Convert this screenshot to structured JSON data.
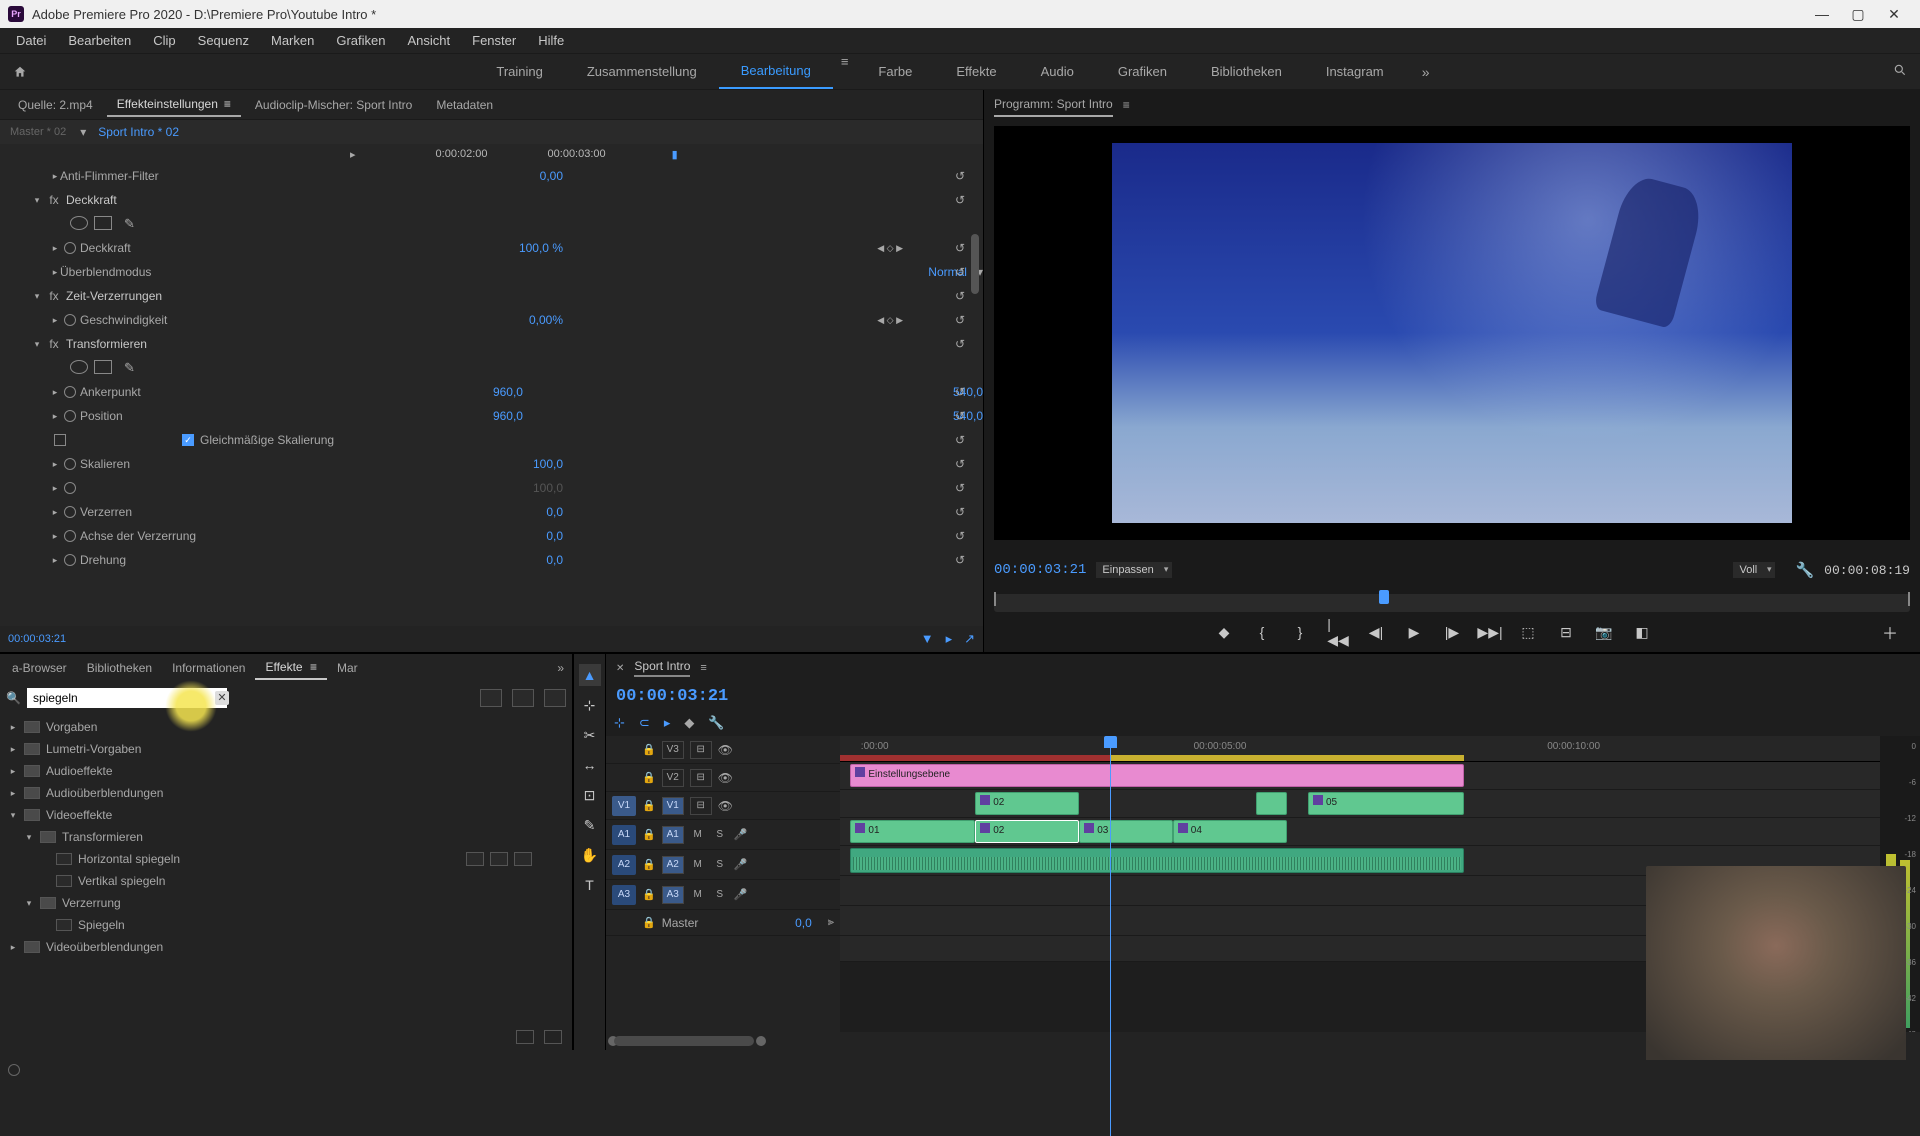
{
  "titlebar": {
    "app_icon_text": "Pr",
    "title": "Adobe Premiere Pro 2020 - D:\\Premiere Pro\\Youtube Intro *"
  },
  "menubar": [
    "Datei",
    "Bearbeiten",
    "Clip",
    "Sequenz",
    "Marken",
    "Grafiken",
    "Ansicht",
    "Fenster",
    "Hilfe"
  ],
  "workspaces": [
    "Training",
    "Zusammenstellung",
    "Bearbeitung",
    "Farbe",
    "Effekte",
    "Audio",
    "Grafiken",
    "Bibliotheken",
    "Instagram"
  ],
  "workspace_active": "Bearbeitung",
  "source_tabs": {
    "source": "Quelle: 2.mp4",
    "effect_controls": "Effekteinstellungen",
    "audio_mixer": "Audioclip-Mischer: Sport Intro",
    "metadata": "Metadaten"
  },
  "effect_controls": {
    "master": "Master * 02",
    "current": "Sport Intro * 02",
    "tc_in": "0:00:02:00",
    "tc_out": "00:00:03:00",
    "footer_tc": "00:00:03:21",
    "rows": [
      {
        "type": "prop",
        "label": "Anti-Flimmer-Filter",
        "val": "0,00",
        "indent": 2
      },
      {
        "type": "section",
        "label": "Deckkraft",
        "indent": 1,
        "fx": true,
        "masks": true
      },
      {
        "type": "prop",
        "label": "Deckkraft",
        "val": "100,0 %",
        "indent": 2,
        "kf": true,
        "sw": true
      },
      {
        "type": "prop",
        "label": "Überblendmodus",
        "val": "Normal",
        "indent": 2,
        "dropdown": true
      },
      {
        "type": "section",
        "label": "Zeit-Verzerrungen",
        "indent": 1,
        "fx": true
      },
      {
        "type": "prop",
        "label": "Geschwindigkeit",
        "val": "0,00%",
        "indent": 2,
        "kf": true,
        "sw": true
      },
      {
        "type": "section",
        "label": "Transformieren",
        "indent": 1,
        "fx": true,
        "masks": true
      },
      {
        "type": "prop",
        "label": "Ankerpunkt",
        "val": "960,0",
        "val2": "540,0",
        "indent": 2,
        "sw": true
      },
      {
        "type": "prop",
        "label": "Position",
        "val": "960,0",
        "val2": "540,0",
        "indent": 2,
        "sw": true
      },
      {
        "type": "check",
        "label": "Gleichmäßige Skalierung",
        "indent": 2,
        "checked": true
      },
      {
        "type": "prop",
        "label": "Skalieren",
        "val": "100,0",
        "indent": 2,
        "sw": true
      },
      {
        "type": "prop",
        "label": "",
        "val": "100,0",
        "indent": 2,
        "dim": true,
        "sw": true
      },
      {
        "type": "prop",
        "label": "Verzerren",
        "val": "0,0",
        "indent": 2,
        "sw": true
      },
      {
        "type": "prop",
        "label": "Achse der Verzerrung",
        "val": "0,0",
        "indent": 2,
        "sw": true
      },
      {
        "type": "prop",
        "label": "Drehung",
        "val": "0,0",
        "indent": 2,
        "sw": true
      }
    ]
  },
  "program": {
    "title": "Programm: Sport Intro",
    "tc": "00:00:03:21",
    "zoom": "Einpassen",
    "res": "Voll",
    "duration": "00:00:08:19"
  },
  "effects_panel": {
    "tabs": [
      "a-Browser",
      "Bibliotheken",
      "Informationen",
      "Effekte",
      "Mar"
    ],
    "active": "Effekte",
    "search": "spiegeln",
    "tree": [
      {
        "label": "Vorgaben",
        "d": 0,
        "folder": true,
        "tw": "▸"
      },
      {
        "label": "Lumetri-Vorgaben",
        "d": 0,
        "folder": true,
        "tw": "▸"
      },
      {
        "label": "Audioeffekte",
        "d": 0,
        "folder": true,
        "tw": "▸"
      },
      {
        "label": "Audioüberblendungen",
        "d": 0,
        "folder": true,
        "tw": "▸"
      },
      {
        "label": "Videoeffekte",
        "d": 0,
        "folder": true,
        "tw": "▾"
      },
      {
        "label": "Transformieren",
        "d": 1,
        "folder": true,
        "tw": "▾"
      },
      {
        "label": "Horizontal spiegeln",
        "d": 2,
        "folder": false,
        "badges": 3
      },
      {
        "label": "Vertikal spiegeln",
        "d": 2,
        "folder": false
      },
      {
        "label": "Verzerrung",
        "d": 1,
        "folder": true,
        "tw": "▾"
      },
      {
        "label": "Spiegeln",
        "d": 2,
        "folder": false
      },
      {
        "label": "Videoüberblendungen",
        "d": 0,
        "folder": true,
        "tw": "▸"
      }
    ]
  },
  "timeline": {
    "seq_name": "Sport Intro",
    "tc": "00:00:03:21",
    "ruler": [
      {
        "label": ":00:00",
        "pct": 2
      },
      {
        "label": "00:00:05:00",
        "pct": 34
      },
      {
        "label": "00:00:10:00",
        "pct": 68
      }
    ],
    "playhead_pct": 26,
    "work_end_pct": 60,
    "tracks_v": [
      {
        "name": "V3",
        "clips": [
          {
            "label": "Einstellungsebene",
            "type": "adj",
            "l": 1,
            "w": 59,
            "fx": true
          }
        ]
      },
      {
        "name": "V2",
        "clips": [
          {
            "label": "02",
            "type": "v",
            "l": 13,
            "w": 10,
            "fx": true
          },
          {
            "label": "",
            "type": "v",
            "l": 40,
            "w": 3
          },
          {
            "label": "05",
            "type": "v",
            "l": 45,
            "w": 15,
            "fx": true
          }
        ]
      },
      {
        "name": "V1",
        "src": "V1",
        "clips": [
          {
            "label": "01",
            "type": "v",
            "l": 1,
            "w": 12,
            "fx": true
          },
          {
            "label": "02",
            "type": "v",
            "l": 13,
            "w": 10,
            "fx": true,
            "sel": true
          },
          {
            "label": "03",
            "type": "v",
            "l": 23,
            "w": 9,
            "fx": true
          },
          {
            "label": "04",
            "type": "v",
            "l": 32,
            "w": 11,
            "fx": true
          }
        ]
      }
    ],
    "tracks_a": [
      {
        "name": "A1",
        "src": "A1",
        "clips": [
          {
            "type": "a",
            "l": 1,
            "w": 59
          }
        ]
      },
      {
        "name": "A2",
        "src": "A2"
      },
      {
        "name": "A3",
        "src": "A3"
      }
    ],
    "master": {
      "label": "Master",
      "val": "0,0"
    }
  },
  "meters": [
    "0",
    "-6",
    "-12",
    "-18",
    "-24",
    "-30",
    "-36",
    "-42",
    "-48"
  ],
  "tools": [
    "▲",
    "⊹",
    "✂",
    "↔",
    "⊡",
    "✎",
    "✋",
    "T"
  ]
}
